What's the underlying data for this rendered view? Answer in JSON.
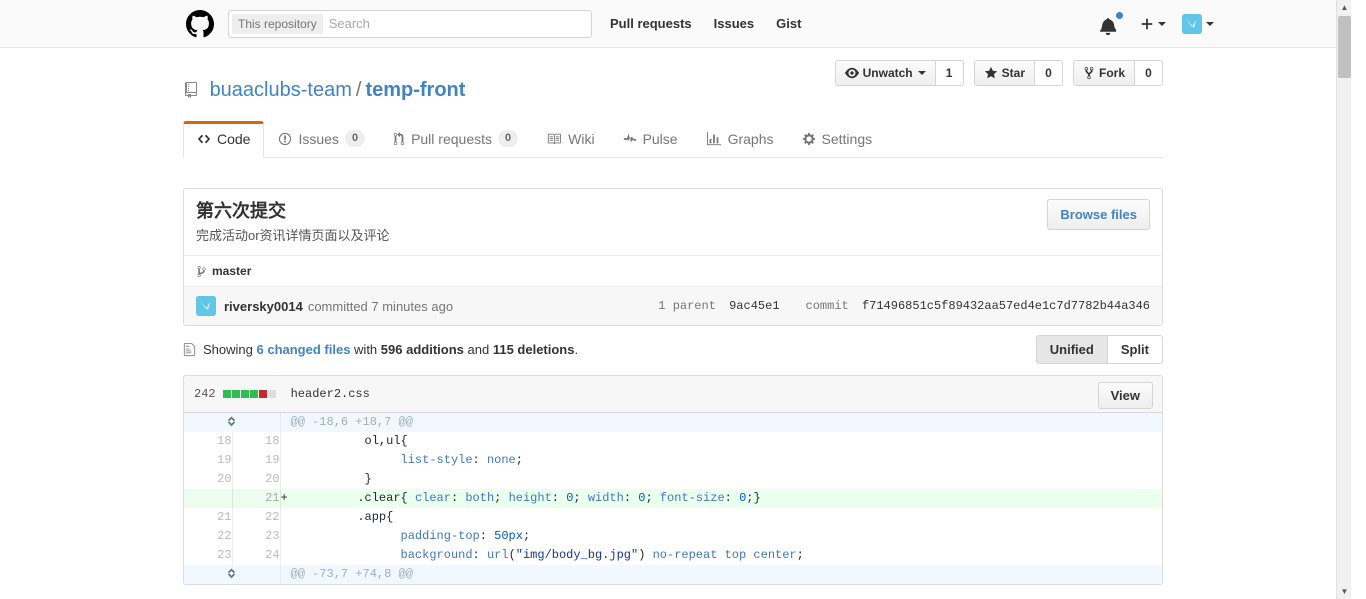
{
  "header": {
    "logo_icon": "github-mark-icon",
    "search": {
      "scope_label": "This repository",
      "placeholder": "Search",
      "value": ""
    },
    "nav": [
      {
        "label": "Pull requests"
      },
      {
        "label": "Issues"
      },
      {
        "label": "Gist"
      }
    ],
    "notifications_icon": "bell-icon",
    "create_new_icon": "plus-icon",
    "avatar_icon": "user-avatar-icon",
    "accent_blue": "#4183c4",
    "avatar_color": "#61c6e8"
  },
  "repo": {
    "icon": "repo-icon",
    "owner": "buaaclubs-team",
    "separator": "/",
    "name": "temp-front",
    "actions": {
      "watch": {
        "label": "Unwatch",
        "count": "1",
        "icon": "eye-icon"
      },
      "star": {
        "label": "Star",
        "count": "0",
        "icon": "star-icon"
      },
      "fork": {
        "label": "Fork",
        "count": "0",
        "icon": "fork-icon"
      }
    }
  },
  "tabs": [
    {
      "label": "Code",
      "icon": "code-icon",
      "selected": true
    },
    {
      "label": "Issues",
      "icon": "issue-opened-icon",
      "count": "0",
      "selected": false
    },
    {
      "label": "Pull requests",
      "icon": "git-pull-request-icon",
      "count": "0",
      "selected": false
    },
    {
      "label": "Wiki",
      "icon": "book-icon",
      "selected": false
    },
    {
      "label": "Pulse",
      "icon": "pulse-icon",
      "selected": false
    },
    {
      "label": "Graphs",
      "icon": "graph-icon",
      "selected": false
    },
    {
      "label": "Settings",
      "icon": "gear-icon",
      "selected": false
    }
  ],
  "commit": {
    "title": "第六次提交",
    "description": "完成活动or资讯详情页面以及评论",
    "browse_files_label": "Browse files",
    "branch_icon": "git-branch-icon",
    "branch": "master",
    "author": "riversky0014",
    "committed_text": "committed 7 minutes ago",
    "parent_label": "1 parent",
    "parent_sha": "9ac45e1",
    "commit_label": "commit",
    "commit_sha": "f71496851c5f89432aa57ed4e1c7d7782b44a346"
  },
  "toolbar": {
    "file_icon": "diff-file-icon",
    "showing_prefix": "Showing",
    "changed_files_link": "6 changed files",
    "with_text": "with",
    "additions": "596 additions",
    "and_text": "and",
    "deletions": "115 deletions",
    "period": ".",
    "unified_label": "Unified",
    "split_label": "Split",
    "selected_view": "Unified"
  },
  "file": {
    "changes": "242",
    "blocks": [
      "add",
      "add",
      "add",
      "add",
      "del",
      "neu"
    ],
    "name": "header2.css",
    "view_label": "View",
    "expander_icon": "unfold-icon",
    "hunks": [
      {
        "header": "@@ -18,6 +18,7 @@",
        "lines": [
          {
            "type": "ctx",
            "old": "18",
            "new": "18",
            "marker": "",
            "code": "        ol,ul{"
          },
          {
            "type": "ctx",
            "old": "19",
            "new": "19",
            "marker": "",
            "code": "            list-style: none;"
          },
          {
            "type": "ctx",
            "old": "20",
            "new": "20",
            "marker": "",
            "code": "        }"
          },
          {
            "type": "add",
            "old": "",
            "new": "21",
            "marker": "+",
            "code": "        .clear{ clear: both; height: 0; width: 0; font-size: 0;}"
          },
          {
            "type": "ctx",
            "old": "21",
            "new": "22",
            "marker": "",
            "code": "        .app{"
          },
          {
            "type": "ctx",
            "old": "22",
            "new": "23",
            "marker": "",
            "code": "            padding-top: 50px;"
          },
          {
            "type": "ctx",
            "old": "23",
            "new": "24",
            "marker": "",
            "code": "            background: url(\"img/body_bg.jpg\") no-repeat top center;"
          }
        ]
      },
      {
        "header": "@@ -73,7 +74,8 @@",
        "lines": []
      }
    ]
  },
  "scrollbar": {
    "up_arrow": "▲",
    "down_arrow": "▼"
  }
}
